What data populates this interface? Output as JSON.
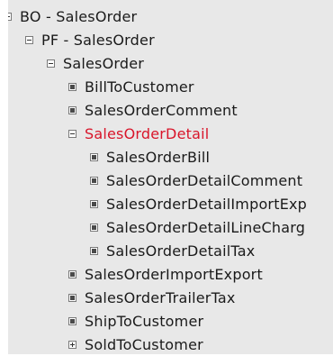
{
  "tree": {
    "selected_color": "#d9152a",
    "nodes": [
      {
        "label": "BO - SalesOrder",
        "state": "expanded"
      },
      {
        "label": "PF - SalesOrder",
        "state": "expanded"
      },
      {
        "label": "SalesOrder",
        "state": "expanded"
      },
      {
        "label": "BillToCustomer",
        "state": "leaf"
      },
      {
        "label": "SalesOrderComment",
        "state": "leaf"
      },
      {
        "label": "SalesOrderDetail",
        "state": "expanded",
        "selected": true
      },
      {
        "label": "SalesOrderBill",
        "state": "leaf"
      },
      {
        "label": "SalesOrderDetailComment",
        "state": "leaf"
      },
      {
        "label": "SalesOrderDetailImportExp",
        "state": "leaf"
      },
      {
        "label": "SalesOrderDetailLineCharg",
        "state": "leaf"
      },
      {
        "label": "SalesOrderDetailTax",
        "state": "leaf"
      },
      {
        "label": "SalesOrderImportExport",
        "state": "leaf"
      },
      {
        "label": "SalesOrderTrailerTax",
        "state": "leaf"
      },
      {
        "label": "ShipToCustomer",
        "state": "leaf"
      },
      {
        "label": "SoldToCustomer",
        "state": "collapsed"
      }
    ]
  }
}
